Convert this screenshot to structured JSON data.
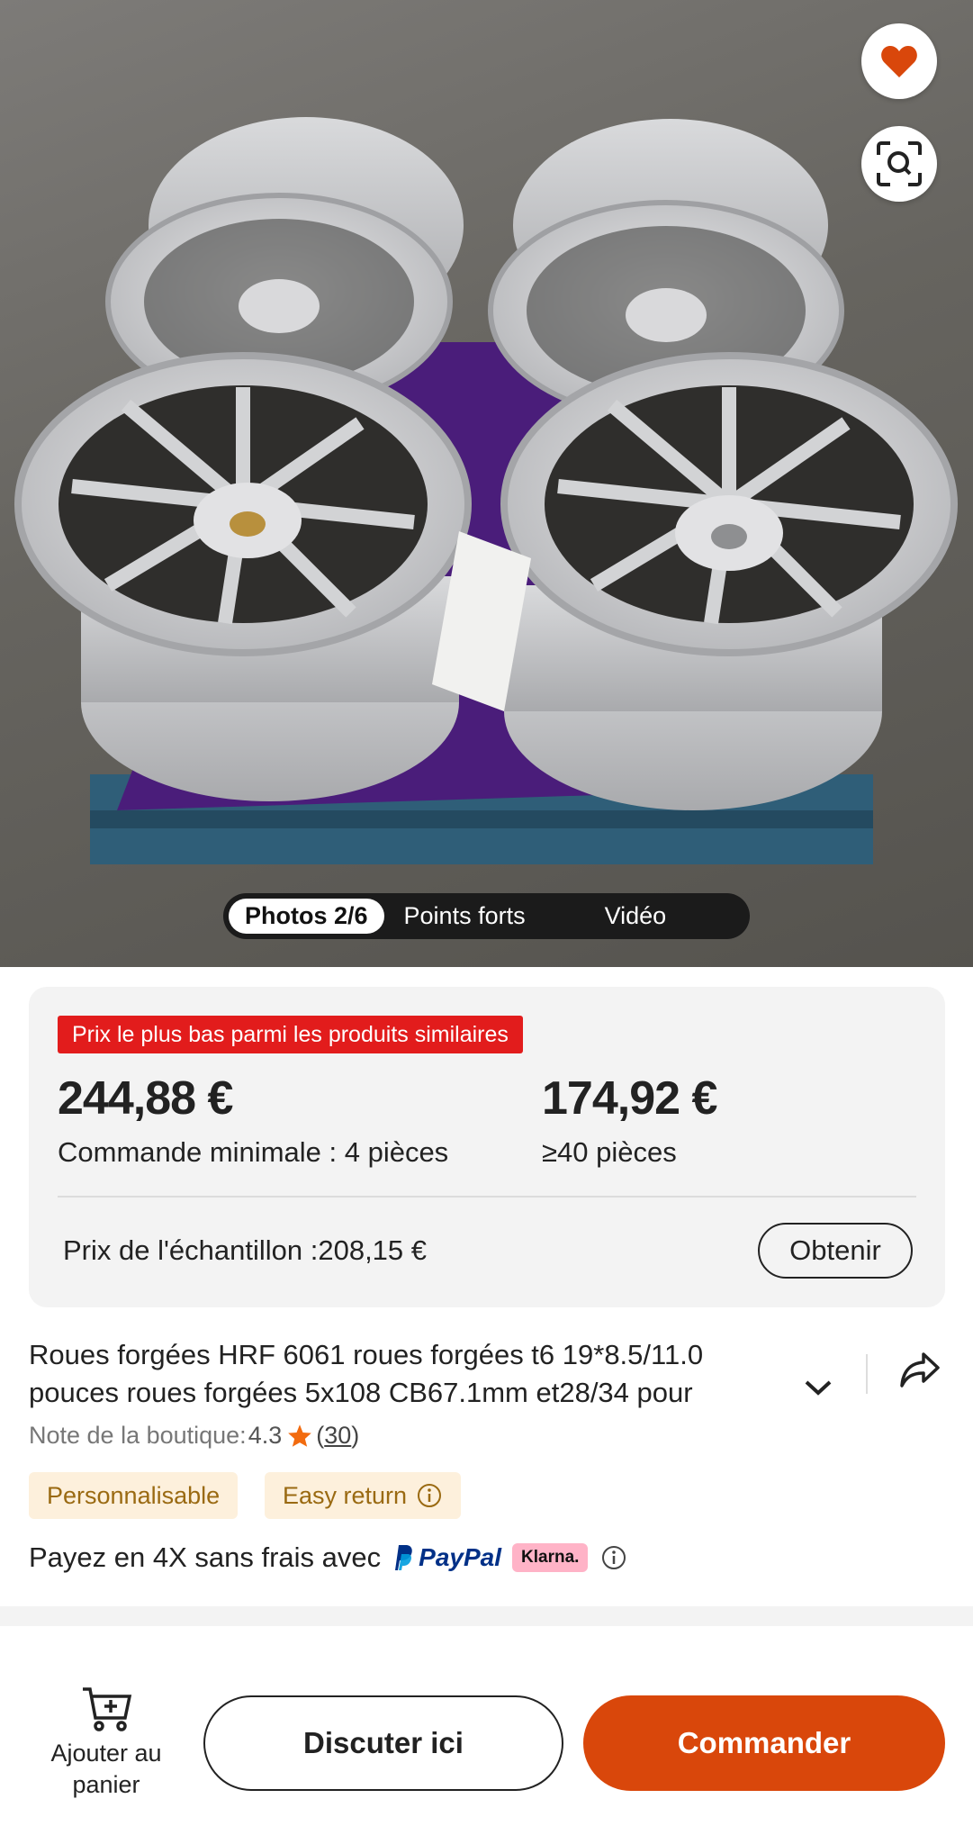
{
  "hero": {
    "image_icon": "wheel-photo",
    "favorite_icon": "heart-icon",
    "scan_icon": "image-search-icon",
    "tabs": [
      {
        "label": "Photos 2/6",
        "active": true
      },
      {
        "label": "Points forts",
        "active": false
      },
      {
        "label": "Vidéo",
        "active": false
      }
    ]
  },
  "pricing": {
    "badge": "Prix le plus bas parmi les produits similaires",
    "tiers": [
      {
        "price": "244,88 €",
        "condition": "Commande minimale : 4 pièces"
      },
      {
        "price": "174,92 €",
        "condition": "≥40 pièces"
      }
    ],
    "sample": "Prix de l'échantillon :208,15 €",
    "obtain_label": "Obtenir"
  },
  "product": {
    "title_line1": "Roues forgées HRF 6061 roues forgées t6 19*8.5/11.0",
    "title_line2": "pouces roues forgées 5x108 CB67.1mm et28/34 pour",
    "rating_label": "Note de la boutique:",
    "rating_value": "4.3",
    "rating_count_open": "(",
    "rating_count": "30",
    "rating_count_close": ")",
    "tags": [
      "Personnalisable",
      "Easy return"
    ]
  },
  "payment": {
    "text": "Payez en 4X sans frais avec",
    "paypal": "PayPal",
    "klarna": "Klarna."
  },
  "bottom_bar": {
    "cart_label": "Ajouter au panier",
    "chat_label": "Discuter ici",
    "order_label": "Commander"
  },
  "colors": {
    "accent": "#d9470b",
    "badge_red": "#e21c1c",
    "tag_bg": "#fdf0dc",
    "tag_text": "#9a6a12",
    "star": "#f26b0f"
  }
}
